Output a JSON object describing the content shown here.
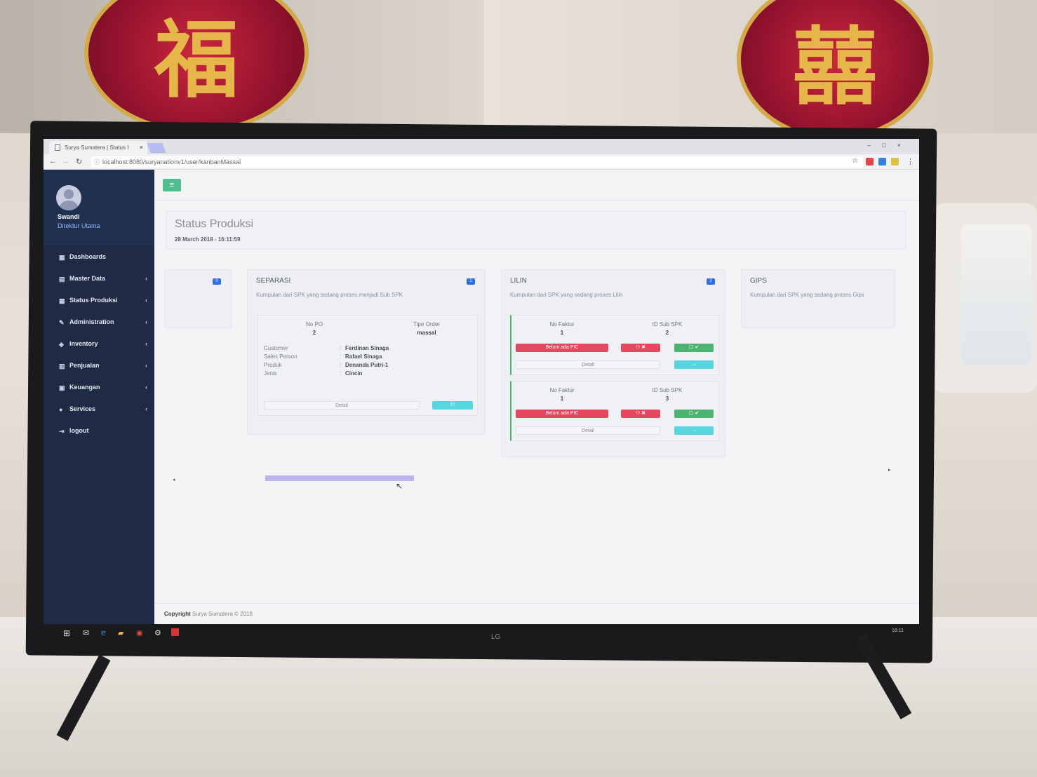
{
  "browser": {
    "tab_title": "Surya Sumatera | Status I",
    "tab_close": "×",
    "url": "localhost:8080/suryanationv1/user/kanbanMassal"
  },
  "sidebar": {
    "user_name": "Swandi",
    "user_role": "Direktur Utama",
    "items": [
      {
        "label": "Dashboards",
        "icon": "grid-icon",
        "has_submenu": false
      },
      {
        "label": "Master Data",
        "icon": "file-icon",
        "has_submenu": true
      },
      {
        "label": "Status Produksi",
        "icon": "grid-icon",
        "has_submenu": true
      },
      {
        "label": "Administration",
        "icon": "edit-icon",
        "has_submenu": true
      },
      {
        "label": "Inventory",
        "icon": "box-icon",
        "has_submenu": true
      },
      {
        "label": "Penjualan",
        "icon": "bar-chart-icon",
        "has_submenu": true
      },
      {
        "label": "Keuangan",
        "icon": "money-icon",
        "has_submenu": true
      },
      {
        "label": "Services",
        "icon": "info-icon",
        "has_submenu": true
      },
      {
        "label": "logout",
        "icon": "logout-icon",
        "has_submenu": false
      }
    ]
  },
  "header": {
    "menu_button": "≡",
    "title": "Status Produksi",
    "timestamp": "28 March 2018 - 16:11:59"
  },
  "board": {
    "first_column": {
      "badge": "0"
    },
    "separasi": {
      "title": "SEPARASI",
      "badge": "1",
      "description": "Kumpulan dari SPK yang sedang proses menjadi Sub SPK",
      "card": {
        "no_po_label": "No PO",
        "no_po": "2",
        "tipe_order_label": "Tipe Order",
        "tipe_order": "massal",
        "customer_label": "Customer",
        "customer": "Ferdinan Sinaga",
        "sales_label": "Sales Person",
        "sales": "Rafael Sinaga",
        "produk_label": "Produk",
        "produk": "Denanda Putri-1",
        "jenis_label": "Jenis",
        "jenis": "Cincin",
        "separator": ":",
        "detail_label": "Detail"
      }
    },
    "lilin": {
      "title": "LILIN",
      "badge": "2",
      "description": "Kumpulan dari SPK yang sedang proses Lilin",
      "cards": [
        {
          "no_faktur_label": "No Faktur",
          "no_faktur": "1",
          "id_sub_label": "ID Sub SPK",
          "id_sub": "2",
          "pic_label": "Belum ada PIC",
          "detail_label": "Detail"
        },
        {
          "no_faktur_label": "No Faktur",
          "no_faktur": "1",
          "id_sub_label": "ID Sub SPK",
          "id_sub": "3",
          "pic_label": "Belum ada PIC",
          "detail_label": "Detail"
        }
      ]
    },
    "gips": {
      "title": "GIPS",
      "description": "Kumpulan dari SPK yang sedang proses Gips"
    }
  },
  "footer": {
    "copyright_label": "Copyright",
    "copyright_text": "Surya Sumatera © 2018"
  },
  "tv": {
    "brand": "LG",
    "clock": "16:11"
  },
  "colors": {
    "sidebar": "#1f2a44",
    "badge": "#2f6fe6",
    "danger": "#e6475f",
    "success": "#4cb470",
    "info": "#58d6e0",
    "menu_button": "#4fc08d"
  }
}
